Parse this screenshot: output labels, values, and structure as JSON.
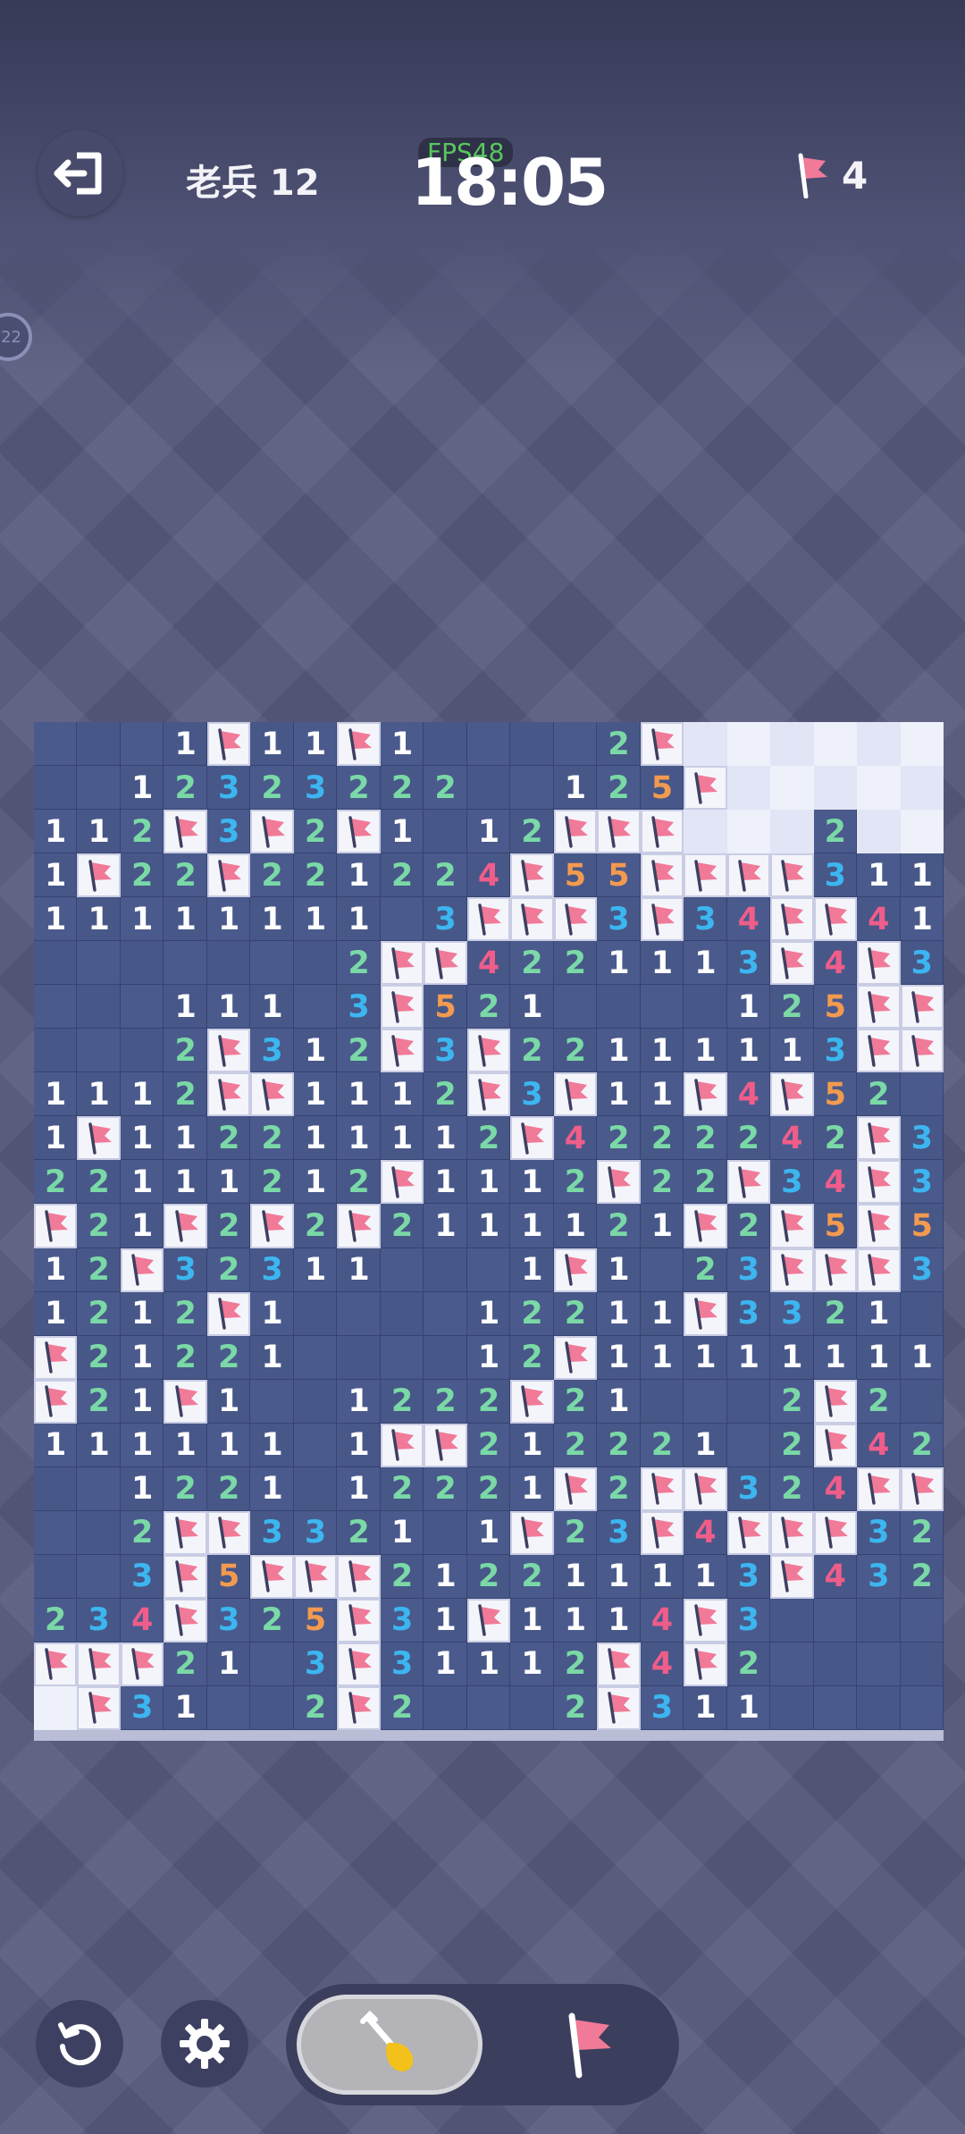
{
  "header": {
    "exit_icon": "exit-icon",
    "level_label": "老兵 12",
    "fps_text": "FPS48",
    "timer": "18:05",
    "flag_count": "4",
    "side_badge": "22"
  },
  "board": {
    "cols": 21,
    "rows_count": 23,
    "legend": "H = hidden, E = revealed empty, F = flag, digits = revealed number",
    "rows": [
      "HHH1F11F1HHHH2FEEEEEE",
      "HH12323222HH125FEEEEE",
      "112F3F2F1H12FFFEEE2EE",
      "1F22F221224F55FFFF311",
      "11111111H3FFF3F34FF411",
      "HHHHHHH2FF4221113F4F3",
      "HHH111H3F521HHHH125FF",
      "HHH2F312F3F22111113FFF",
      "1112FF1112F3F11F4F52",
      "1F11221111 2F4222242F31",
      "22111212F1112F22F34F3",
      "F21F2F2F2111121F2F5F5FF",
      "12F3231 1HHH1F1H23FFF32",
      "1212F1HHHH12211F3321H",
      "F21221HHHH12F11111111H",
      "F21F1HH1222F21HHH2F2H",
      "111111H1FF212221H2F42",
      "HH1221H12221F2FF324FFF",
      "HH2FF3321H1F23F4FFF32",
      "HH3F5FFF212211113F4321H",
      "234F325F31F1114F3HHHH",
      "FFF21H3F31112F4F2HHHH",
      "EF31HH2F2HHH2F311HHHH"
    ]
  },
  "toolbar": {
    "restart_icon": "restart-icon",
    "settings_icon": "gear-icon",
    "dig_mode_icon": "shovel-icon",
    "flag_mode_icon": "flag-icon",
    "selected_mode": "dig"
  },
  "colors": {
    "hidden_tile": "#4a5a8c",
    "revealed_tile": "#eef0fa",
    "number_1": "#ffffff",
    "number_2": "#7ad9a6",
    "number_3": "#3cb6f0",
    "number_4": "#ef5d8a",
    "number_5": "#f29a4f",
    "flag": "#f07a98"
  }
}
